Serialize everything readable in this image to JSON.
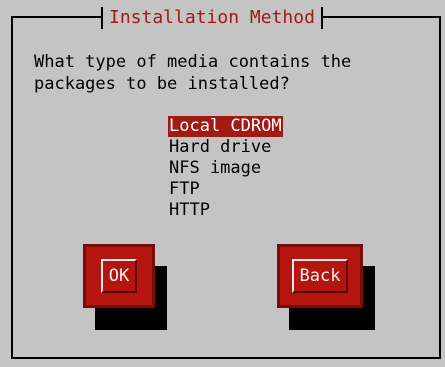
{
  "dialog": {
    "title": "Installation Method",
    "question": "What type of media contains the\npackages to be installed?"
  },
  "media_options": [
    {
      "label": "Local CDROM",
      "selected": true
    },
    {
      "label": "Hard drive",
      "selected": false
    },
    {
      "label": "NFS image",
      "selected": false
    },
    {
      "label": "FTP",
      "selected": false
    },
    {
      "label": "HTTP",
      "selected": false
    }
  ],
  "buttons": {
    "ok_label": "OK",
    "back_label": "Back"
  },
  "colors": {
    "background": "#c4c4c4",
    "accent": "#a11a14",
    "button": "#b4150f"
  }
}
